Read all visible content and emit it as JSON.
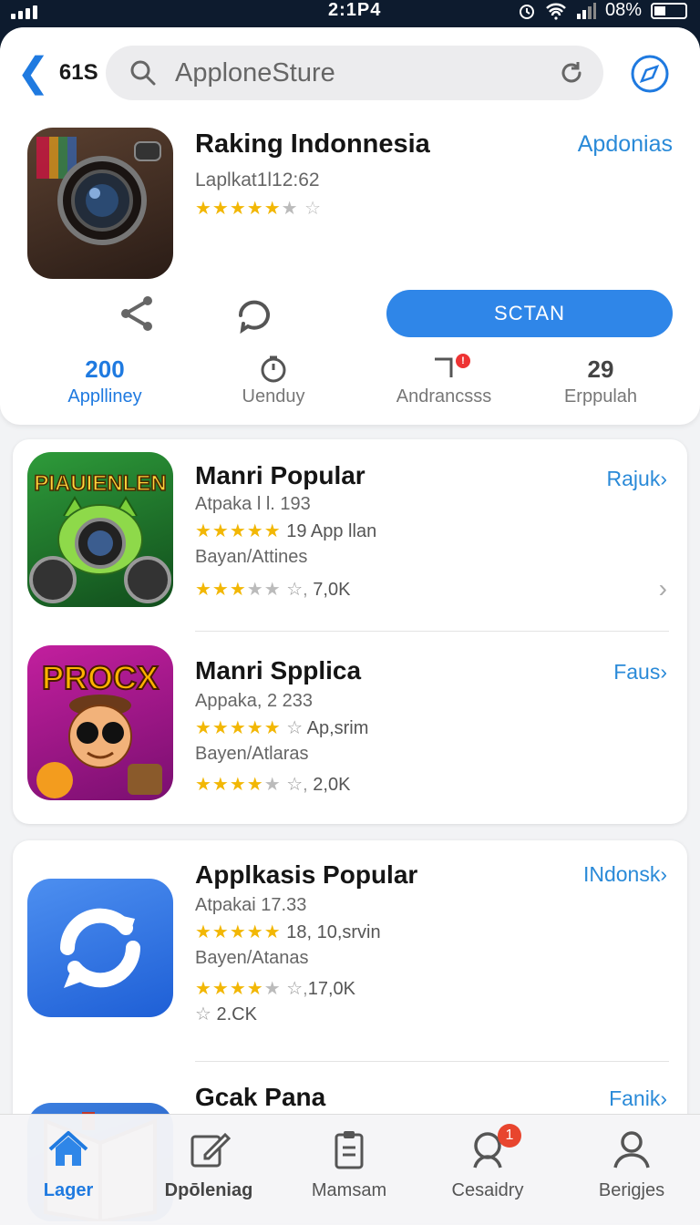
{
  "status_bar": {
    "time": "2:1P4",
    "battery": "08%"
  },
  "header": {
    "back_label": "61S",
    "search_placeholder": "ApploneSture"
  },
  "featured": {
    "title": "Raking Indonnesia",
    "subtitle": "Laplkat1l12:62",
    "link": "Apdonias",
    "rating": 4.5,
    "primary_button": "SCTAN",
    "stats": [
      {
        "value": "200",
        "label": "Applliney",
        "icon": ""
      },
      {
        "value": "",
        "label": "Uenduy",
        "icon": "timer-icon"
      },
      {
        "value": "",
        "label": "Andrancsss",
        "icon": "corner-icon"
      },
      {
        "value": "29",
        "label": "Erppulah",
        "icon": ""
      }
    ]
  },
  "popular_section": {
    "apps": [
      {
        "title": "Manri Popular",
        "line1": "Atpaka l l. 193",
        "stars1_text": "19 App llan",
        "line2": "Bayan/Attines",
        "stars2_text": "7,0K",
        "link": "Rajuk",
        "icon_text": "PIAUIENLEN",
        "icon_colors": [
          "#2e9b3a",
          "#114d1c"
        ]
      },
      {
        "title": "Manri Spplica",
        "line1": "Appaka, 2 233",
        "stars1_text": "Ap,srim",
        "line2": "Bayen/Atlaras",
        "stars2_text": "2,0K",
        "link": "Faus",
        "icon_text": "PROCX",
        "icon_colors": [
          "#c21f9e",
          "#7a0f70"
        ]
      }
    ]
  },
  "applikasi_section": {
    "apps": [
      {
        "title": "Applkasis Popular",
        "line1": "Atpakai 17.33",
        "stars1_text": "18, 10,srvin",
        "line2": "Bayen/Atanas",
        "stars2_text": "17,0K",
        "extra": "2.CK",
        "link": "INdonsk",
        "icon_colors": [
          "#4d8ff0",
          "#1e5fd6"
        ]
      },
      {
        "title": "Gcak Pana",
        "link": "Fanik"
      }
    ]
  },
  "tabbar": {
    "tabs": [
      {
        "label": "Lager",
        "icon": "home-icon"
      },
      {
        "label": "Dpōleniag",
        "icon": "edit-icon"
      },
      {
        "label": "Mamsam",
        "icon": "clipboard-icon"
      },
      {
        "label": "Cesaidry",
        "icon": "search-person-icon",
        "badge": "1"
      },
      {
        "label": "Berigjes",
        "icon": "profile-icon"
      }
    ]
  },
  "colors": {
    "accent": "#2f86e8",
    "star": "#f2b705",
    "badge": "#e8452e"
  }
}
